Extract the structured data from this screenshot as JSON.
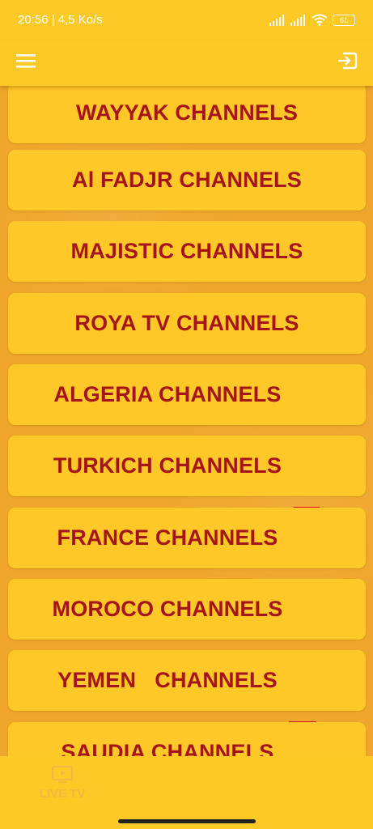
{
  "status": {
    "time_speed": "20:56 | 4,5 Ko/s",
    "battery": "61"
  },
  "appbar": {
    "menu_icon": "hamburger-menu-icon",
    "logout_icon": "logout-icon"
  },
  "channels": [
    {
      "label": "WAYYAK CHANNELS",
      "flag": ""
    },
    {
      "label": "Al FADJR CHANNELS",
      "flag": ""
    },
    {
      "label": "MAJISTIC CHANNELS",
      "flag": ""
    },
    {
      "label": "ROYA TV CHANNELS",
      "flag": ""
    },
    {
      "label": "ALGERIA CHANNELS",
      "flag": "algeria-flag-icon"
    },
    {
      "label": "TURKICH CHANNELS",
      "flag": "turkey-flag-icon"
    },
    {
      "label": "FRANCE CHANNELS",
      "flag": "france-flag-icon"
    },
    {
      "label": "MOROCO CHANNELS",
      "flag": "morocco-flag-icon"
    },
    {
      "label": "YEMEN   CHANNELS",
      "flag": "yemen-flag-icon"
    },
    {
      "label": "SAUDIA CHANNELS",
      "flag": "saudi-flag-icon"
    }
  ],
  "bottom_nav": {
    "label": "LIVE TV",
    "icon": "tv-play-icon"
  },
  "colors": {
    "appbar": "#fdc926",
    "background": "#efa62b",
    "card": "#fec828",
    "text": "#a5141b"
  }
}
